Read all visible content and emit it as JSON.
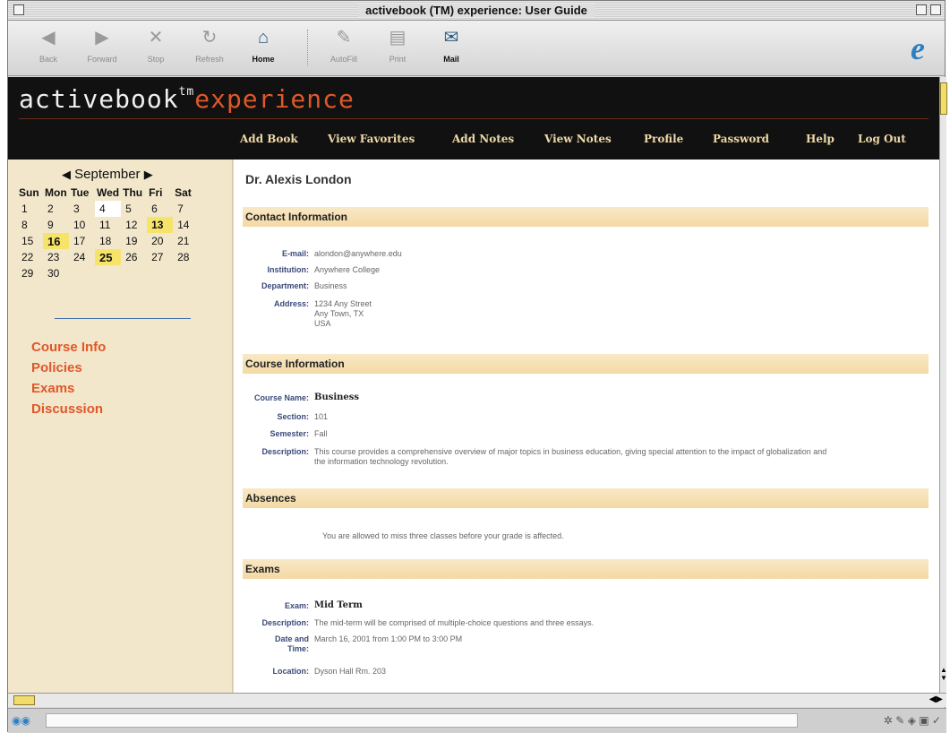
{
  "window": {
    "title": "activebook (TM) experience: User Guide"
  },
  "toolbar": {
    "buttons": [
      {
        "label": "Back",
        "icon": "back-arrow-icon",
        "glyph": "◀"
      },
      {
        "label": "Forward",
        "icon": "forward-arrow-icon",
        "glyph": "▶"
      },
      {
        "label": "Stop",
        "icon": "stop-icon",
        "glyph": "✕"
      },
      {
        "label": "Refresh",
        "icon": "refresh-icon",
        "glyph": "↻"
      },
      {
        "label": "Home",
        "icon": "home-icon",
        "glyph": "⌂"
      },
      {
        "label": "AutoFill",
        "icon": "autofill-icon",
        "glyph": "✎"
      },
      {
        "label": "Print",
        "icon": "print-icon",
        "glyph": "▤"
      },
      {
        "label": "Mail",
        "icon": "mail-icon",
        "glyph": "✉"
      }
    ],
    "browser_logo": "e"
  },
  "header": {
    "brand_part1": "activebook",
    "brand_tm": "tm",
    "brand_part2": "experience",
    "nav": [
      "Add Book",
      "View Favorites",
      "Add Notes",
      "View Notes",
      "Profile",
      "Password",
      "Help",
      "Log Out"
    ]
  },
  "calendar": {
    "month": "September",
    "prev_glyph": "◀",
    "next_glyph": "▶",
    "weekdays": [
      "Sun",
      "Mon",
      "Tue",
      "Wed",
      "Thu",
      "Fri",
      "Sat"
    ],
    "weeks": [
      [
        "1",
        "2",
        "3",
        "4",
        "5",
        "6",
        "7"
      ],
      [
        "8",
        "9",
        "10",
        "11",
        "12",
        "13",
        "14"
      ],
      [
        "15",
        "16",
        "17",
        "18",
        "19",
        "20",
        "21"
      ],
      [
        "22",
        "23",
        "24",
        "25",
        "26",
        "27",
        "28"
      ],
      [
        "29",
        "30",
        "",
        "",
        "",
        "",
        ""
      ]
    ],
    "today": "4",
    "highlighted": [
      "13",
      "16",
      "25"
    ]
  },
  "sidebar": {
    "links": [
      "Course Info",
      "Policies",
      "Exams",
      "Discussion"
    ]
  },
  "main": {
    "name": "Dr. Alexis London",
    "contact": {
      "title": "Contact Information",
      "email_label": "E-mail:",
      "email": "alondon@anywhere.edu",
      "institution_label": "Institution:",
      "institution": "Anywhere College",
      "department_label": "Department:",
      "department": "Business",
      "address_label": "Address:",
      "address_lines": [
        "1234 Any Street",
        "Any Town, TX",
        "USA"
      ]
    },
    "course": {
      "title": "Course Information",
      "name_label": "Course Name:",
      "name": "Business",
      "section_label": "Section:",
      "section": "101",
      "semester_label": "Semester:",
      "semester": "Fall",
      "description_label": "Description:",
      "description_lines": [
        "This course provides a comprehensive overview of major topics in business education, giving special attention to the impact of globalization and",
        "the information technology revolution."
      ]
    },
    "absences": {
      "title": "Absences",
      "text": "You are allowed to miss three classes before your grade is affected."
    },
    "exams": {
      "title": "Exams",
      "exam_label": "Exam:",
      "exam": "Mid Term",
      "description_label": "Description:",
      "description": "The mid-term will be comprised of multiple-choice questions and three essays.",
      "datetime_label_lines": [
        "Date and",
        "Time:"
      ],
      "datetime": "March 16, 2001 from 1:00 PM to 3:00 PM",
      "location_label": "Location:",
      "location": "Dyson Hall Rm. 203"
    }
  },
  "colors": {
    "accent": "#e0572a",
    "nav_text": "#efd9a6",
    "section_bar": "#f3d9a4",
    "sidebar_bg": "#f2e7cb",
    "calendar_highlight": "#f6e46a"
  }
}
